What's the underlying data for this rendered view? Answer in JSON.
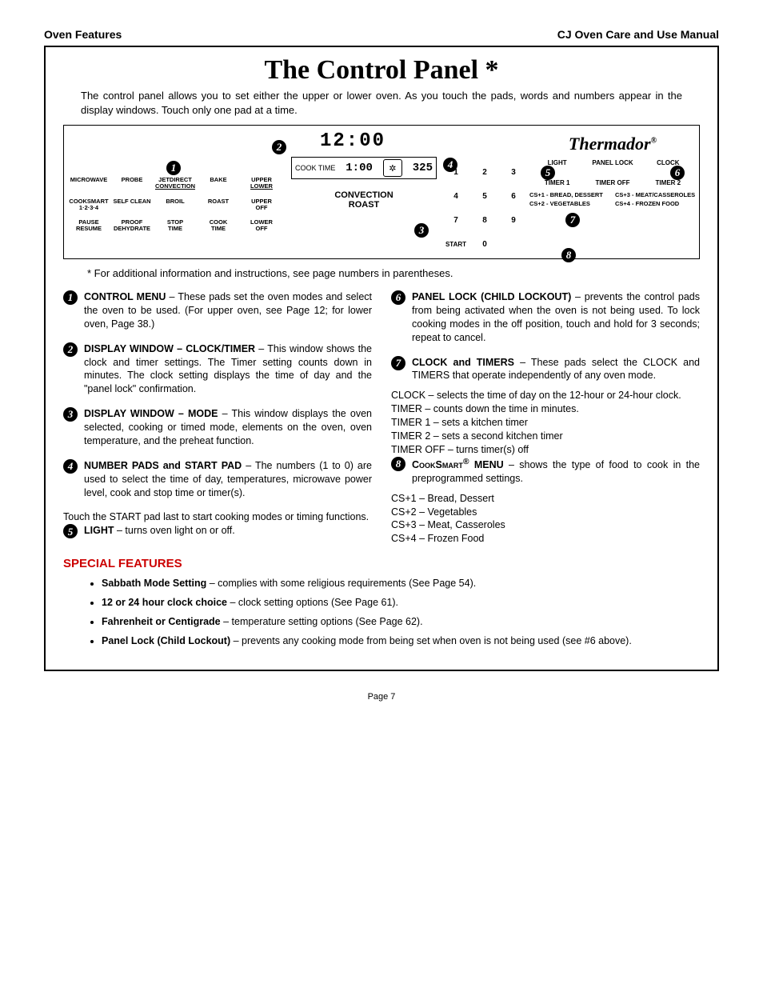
{
  "header": {
    "left": "Oven Features",
    "right": "CJ Oven Care and Use Manual"
  },
  "title": "The Control Panel *",
  "intro": "The control panel allows you to set either the upper or lower oven. As you touch the pads, words and numbers appear in the display windows. Touch only one pad at a time.",
  "diagram": {
    "clock_display": "12:00",
    "cook_time_label": "COOK TIME",
    "cook_time_value": "1:00",
    "temp_value": "325",
    "mode_line1": "CONVECTION",
    "mode_line2": "ROAST",
    "brand": "Thermador",
    "brand_reg": "®",
    "pads_col1": [
      "MICROWAVE",
      "COOKSMART\n1·2·3·4",
      "PAUSE\nRESUME"
    ],
    "pads_col2": [
      "PROBE",
      "SELF CLEAN",
      "PROOF\nDEHYDRATE"
    ],
    "pads_col3_top": "JETDIRECT",
    "pads_col3_top_under": "CONVECTION",
    "pads_col3": [
      "BROIL",
      "STOP\nTIME"
    ],
    "pads_col4": [
      "BAKE",
      "ROAST",
      "COOK\nTIME"
    ],
    "pads_col5_top": "UPPER",
    "pads_col5_top_under": "LOWER",
    "pads_col5": [
      "UPPER\nOFF",
      "LOWER\nOFF"
    ],
    "keypad": [
      "1",
      "2",
      "3",
      "4",
      "5",
      "6",
      "7",
      "8",
      "9",
      "START",
      "0",
      ""
    ],
    "right_row1": [
      "LIGHT",
      "PANEL LOCK",
      "CLOCK"
    ],
    "right_row2": [
      "TIMER 1",
      "",
      "TIMER OFF",
      "",
      "TIMER 2"
    ],
    "cooksmart": [
      "CS+1 - BREAD, DESSERT",
      "CS+3 - MEAT/CASSEROLES",
      "CS+2 - VEGETABLES",
      "CS+4 - FROZEN FOOD"
    ],
    "callouts": [
      "1",
      "2",
      "3",
      "4",
      "5",
      "6",
      "7",
      "8"
    ]
  },
  "footnote": "* For additional information and instructions, see page numbers in parentheses.",
  "descriptions_left": [
    {
      "n": "1",
      "bold": "CONTROL MENU",
      "text": " – These pads set the oven modes and select the oven to be used. (For upper oven, see Page 12; for lower oven, Page 38.)"
    },
    {
      "n": "2",
      "bold": "DISPLAY WINDOW – CLOCK/TIMER",
      "text": " – This window shows the clock and timer settings. The Timer setting counts down in minutes. The clock setting displays the time of day and the \"panel lock\" confirmation."
    },
    {
      "n": "3",
      "bold": "DISPLAY WINDOW – MODE",
      "text": " – This window displays the oven selected, cooking or timed mode, elements on the oven, oven temperature, and the preheat function."
    },
    {
      "n": "4",
      "bold": "NUMBER PADS and START PAD",
      "text": " – The numbers (1 to 0) are used to select the time of day, temperatures, microwave power level, cook and stop time or timer(s).",
      "cont": "Touch the START pad last to start cooking modes or timing functions."
    },
    {
      "n": "5",
      "bold": "LIGHT",
      "text": " – turns oven light on or off."
    }
  ],
  "descriptions_right": [
    {
      "n": "6",
      "bold": "PANEL LOCK (CHILD LOCKOUT)",
      "text": " – prevents the control pads from being activated when the oven is not being used. To lock cooking modes in the off position, touch and hold for 3 seconds; repeat to cancel."
    },
    {
      "n": "7",
      "bold": "CLOCK and TIMERS",
      "text": " – These pads select the CLOCK and TIMERS that operate independently of any oven mode.",
      "cont1": "CLOCK – selects the time of day on the 12-hour or 24-hour clock.",
      "cont2": "TIMER – counts down the time in minutes.",
      "cont3": "TIMER 1 – sets a kitchen timer\nTIMER 2 – sets a second kitchen timer\nTIMER OFF – turns timer(s) off"
    },
    {
      "n": "8",
      "bold_sc": "CookSmart",
      "bold_sup": "®",
      "bold2": " MENU",
      "text": " – shows the type of food to cook in the preprogrammed settings.",
      "cont": "CS+1 – Bread, Dessert\nCS+2 – Vegetables\nCS+3 – Meat, Casseroles\nCS+4 – Frozen Food"
    }
  ],
  "special_heading": "SPECIAL FEATURES",
  "special_items": [
    {
      "bold": "Sabbath Mode Setting",
      "text": " – complies with some religious requirements (See Page 54)."
    },
    {
      "bold": "12 or 24 hour clock choice",
      "text": " – clock setting options (See Page 61)."
    },
    {
      "bold": "Fahrenheit or Centigrade",
      "text": " – temperature setting options (See Page 62)."
    },
    {
      "bold": "Panel Lock (Child Lockout)",
      "text": " – prevents any cooking mode from being set when oven is not being used (see #6 above)."
    }
  ],
  "page_number": "Page 7"
}
